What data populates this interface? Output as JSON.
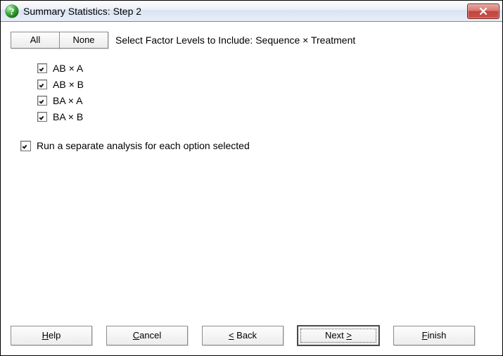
{
  "window": {
    "title": "Summary Statistics: Step 2"
  },
  "toolbar": {
    "all_label": "All",
    "none_label": "None",
    "section_label": "Select Factor Levels to Include: Sequence × Treatment"
  },
  "factors": [
    {
      "label": "AB × A",
      "checked": true
    },
    {
      "label": "AB × B",
      "checked": true
    },
    {
      "label": "BA × A",
      "checked": true
    },
    {
      "label": "BA × B",
      "checked": true
    }
  ],
  "options": {
    "separate_analysis": {
      "label": "Run a separate analysis for each option selected",
      "checked": true
    }
  },
  "footer": {
    "help": {
      "pre": "",
      "m": "H",
      "post": "elp"
    },
    "cancel": {
      "pre": "",
      "m": "C",
      "post": "ancel"
    },
    "back": {
      "pre": "",
      "m": "<",
      "post": " Back"
    },
    "next": {
      "pre": "Next ",
      "m": ">",
      "post": ""
    },
    "finish": {
      "pre": "",
      "m": "F",
      "post": "inish"
    }
  }
}
